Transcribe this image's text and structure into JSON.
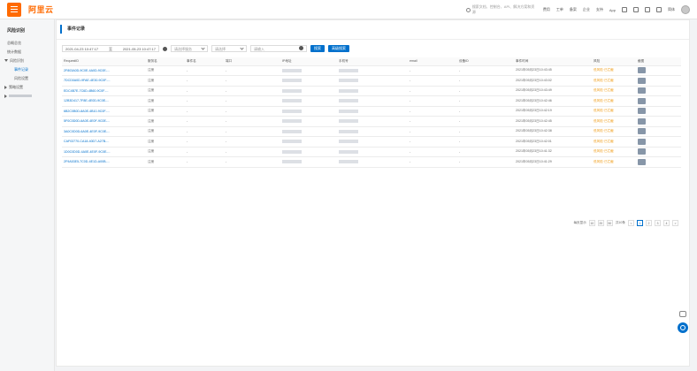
{
  "brand": {
    "logo_icon": "console-menu-icon",
    "name": "阿里云"
  },
  "topbar": {
    "search_placeholder": "搜索文档、控制台、API、解决方案和资源",
    "nav": [
      "费用",
      "工单",
      "备案",
      "企业",
      "支持",
      "App"
    ],
    "icons": [
      "message-icon",
      "notification-icon",
      "cart-icon",
      "help-icon"
    ],
    "lang": "简体"
  },
  "sidebar": {
    "title": "风险识别",
    "items": [
      {
        "label": "总概总览",
        "type": "item"
      },
      {
        "label": "统计数据",
        "type": "item"
      },
      {
        "label": "风险识别",
        "type": "group-open"
      },
      {
        "label": "事件记录",
        "type": "sub-selected"
      },
      {
        "label": "风险设置",
        "type": "sub"
      },
      {
        "label": "策略设置",
        "type": "group-closed"
      }
    ]
  },
  "main": {
    "title": "事件记录",
    "filters": {
      "date_start": "2021-04-23 10:47:17",
      "date_sep": "至",
      "date_end": "2021-05-23 10:47:17",
      "select1": "请选择服务",
      "select2": "请选择",
      "input_placeholder": "请输入",
      "btn_search": "搜索",
      "btn_reset": "高级搜索"
    },
    "columns": [
      "RequestID",
      "服务名",
      "事件名",
      "端口",
      "IP地址",
      "手机号",
      "email",
      "设备ID",
      "事件时间",
      "风险",
      "截图"
    ],
    "rows": [
      {
        "id": "2F803A0D-9C0E-4A0D-9C0E-...",
        "svc": "注册",
        "ev": "-",
        "port": "-",
        "ip": "",
        "phone": "",
        "email": "-",
        "dev": "-",
        "time": "2021年05月23日10:43:45",
        "risk": "低风险·已拦截"
      },
      {
        "id": "7DCD0A0D-9FAE-4E30-9C0F-...",
        "svc": "注册",
        "ev": "-",
        "port": "-",
        "ip": "",
        "phone": "",
        "email": "-",
        "dev": "-",
        "time": "2021年05月23日10:43:02",
        "risk": "低风险·已拦截"
      },
      {
        "id": "EDC4B7E-7C6D-4B60-9C0F-...",
        "svc": "注册",
        "ev": "-",
        "port": "-",
        "ip": "",
        "phone": "",
        "email": "-",
        "dev": "-",
        "time": "2021年05月23日10:43:49",
        "risk": "低风险·已拦截"
      },
      {
        "id": "12B3D417-7F8E-4E0D-9C0E-...",
        "svc": "注册",
        "ev": "-",
        "port": "-",
        "ip": "",
        "phone": "",
        "email": "-",
        "dev": "-",
        "time": "2021年05月23日10:42:46",
        "risk": "低风险·已拦截"
      },
      {
        "id": "6B2C0B0D-8A0E-4B10-9C0F-...",
        "svc": "注册",
        "ev": "-",
        "port": "-",
        "ip": "",
        "phone": "",
        "email": "-",
        "dev": "-",
        "time": "2021年05月23日10:42:19",
        "risk": "低风险·已拦截"
      },
      {
        "id": "5F0C0D0D-6A0E-4E0F-9C0E-...",
        "svc": "注册",
        "ev": "-",
        "port": "-",
        "ip": "",
        "phone": "",
        "email": "-",
        "dev": "-",
        "time": "2021年05月23日10:42:45",
        "risk": "低风险·已拦截"
      },
      {
        "id": "3A0C0D0D-6A0E-4E0F-9C0E-...",
        "svc": "注册",
        "ev": "-",
        "port": "-",
        "ip": "",
        "phone": "",
        "email": "-",
        "dev": "-",
        "time": "2021年05月23日10:42:38",
        "risk": "低风险·已拦截"
      },
      {
        "id": "CAF03770-CA18-40D7-A27B-...",
        "svc": "注册",
        "ev": "-",
        "port": "-",
        "ip": "",
        "phone": "",
        "email": "-",
        "dev": "-",
        "time": "2021年05月23日10:42:01",
        "risk": "低风险·已拦截"
      },
      {
        "id": "1D0C0D0D-4A0E-4E0F-9C0E-...",
        "svc": "注册",
        "ev": "-",
        "port": "-",
        "ip": "",
        "phone": "",
        "email": "-",
        "dev": "-",
        "time": "2021年05月23日10:41:32",
        "risk": "低风险·已拦截"
      },
      {
        "id": "2F9A53E5-7C0D-4E1D-A00B-...",
        "svc": "注册",
        "ev": "-",
        "port": "-",
        "ip": "",
        "phone": "",
        "email": "-",
        "dev": "-",
        "time": "2021年05月23日10:41:29",
        "risk": "低风险·已拦截"
      }
    ]
  },
  "pager": {
    "total_label": "每页显示",
    "sizes": [
      "10",
      "20",
      "50"
    ],
    "jump_label": "共10条",
    "pages": [
      "<",
      "1",
      "2",
      "3",
      "4",
      ">"
    ]
  },
  "colors": {
    "accent": "#0070cc",
    "brand": "#ff6a00",
    "warn": "#f0a020"
  }
}
